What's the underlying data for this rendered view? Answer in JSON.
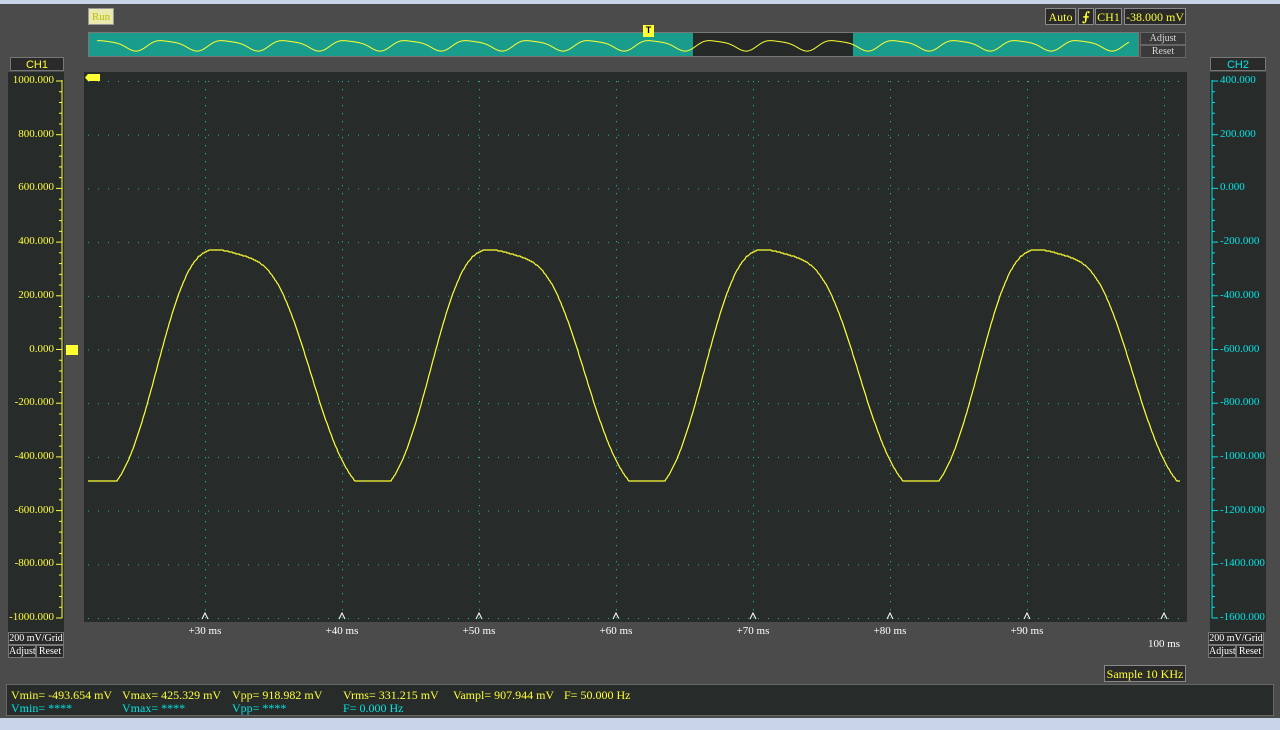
{
  "toolbar": {
    "run_label": "Run",
    "auto_label": "Auto",
    "edge_icon": "rising-edge-icon",
    "trigger_channel": "CH1",
    "trigger_level": "-38.000 mV",
    "adjust_label": "Adjust",
    "reset_label": "Reset",
    "trigger_marker": "T"
  },
  "channels": {
    "ch1": {
      "label": "CH1",
      "color": "#ffff33",
      "ticks": [
        "1000.000",
        "800.000",
        "600.000",
        "400.000",
        "200.000",
        "0.000",
        "-200.000",
        "-400.000",
        "-600.000",
        "-800.000",
        "-1000.000"
      ],
      "scale_label": "200 mV/Grid",
      "adjust_label": "Adjust",
      "reset_label": "Reset"
    },
    "ch2": {
      "label": "CH2",
      "color": "#00e5e5",
      "ticks": [
        "400.000",
        "200.000",
        "0.000",
        "-200.000",
        "-400.000",
        "-600.000",
        "-800.000",
        "-1000.000",
        "-1200.000",
        "-1400.000",
        "-1600.000"
      ],
      "scale_label": "200 mV/Grid",
      "adjust_label": "Adjust",
      "reset_label": "Reset"
    }
  },
  "time_axis": {
    "labels": [
      "+30 ms",
      "+40 ms",
      "+50 ms",
      "+60 ms",
      "+70 ms",
      "+80 ms",
      "+90 ms"
    ],
    "end_label": "100 ms"
  },
  "sample_label": "Sample 10 KHz",
  "measurements": {
    "ch1": {
      "vmin": "Vmin= -493.654 mV",
      "vmax": "Vmax= 425.329 mV",
      "vpp": "Vpp= 918.982 mV",
      "vrms": "Vrms= 331.215 mV",
      "vampl": "Vampl= 907.944 mV",
      "freq": "F= 50.000 Hz"
    },
    "ch2": {
      "vmin": "Vmin= ****",
      "vmax": "Vmax= ****",
      "vpp": "Vpp= ****",
      "freq": "F= 0.000 Hz"
    }
  },
  "colors": {
    "background": "#4b4b4b",
    "plot_bg": "#272c2b",
    "grid_dot": "#1fb0a6",
    "trace": "#ffff33",
    "ch2": "#00e5e5"
  }
}
